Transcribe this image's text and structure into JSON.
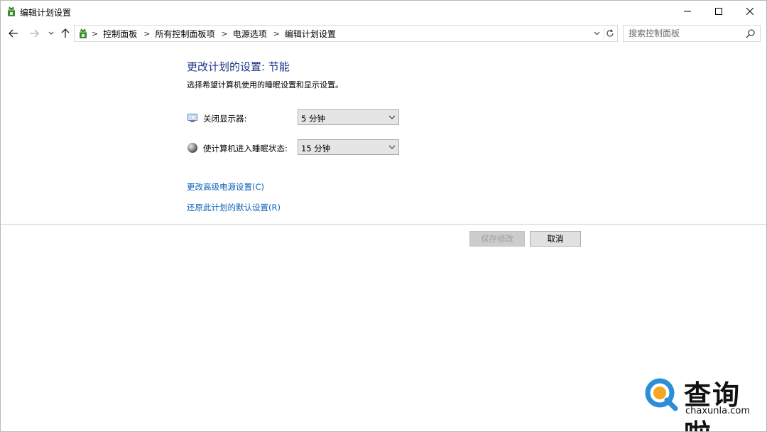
{
  "window": {
    "title": "编辑计划设置",
    "controls": {
      "minimize": "minimize-icon",
      "maximize": "maximize-icon",
      "close": "close-icon"
    }
  },
  "nav": {
    "back_icon": "arrow-left-icon",
    "forward_icon": "arrow-right-icon",
    "recent_icon": "chevron-down-icon",
    "up_icon": "arrow-up-icon",
    "breadcrumbs": [
      "控制面板",
      "所有控制面板项",
      "电源选项",
      "编辑计划设置"
    ],
    "refresh_icon": "refresh-icon",
    "search": {
      "placeholder": "搜索控制面板",
      "value": ""
    }
  },
  "content": {
    "heading": "更改计划的设置: 节能",
    "subtitle": "选择希望计算机使用的睡眠设置和显示设置。",
    "settings": [
      {
        "label": "关闭显示器:",
        "value": "5 分钟",
        "icon": "display-icon"
      },
      {
        "label": "使计算机进入睡眠状态:",
        "value": "15 分钟",
        "icon": "sleep-moon-icon"
      }
    ],
    "links": [
      "更改高级电源设置(C)",
      "还原此计划的默认设置(R)"
    ],
    "buttons": {
      "save": "保存修改",
      "cancel": "取消"
    }
  },
  "watermark": {
    "text": "查询啦",
    "domain": "chaxunla.com"
  },
  "colors": {
    "heading": "#1e3287",
    "link": "#0a63b8",
    "watermark_blue": "#2a8fd8",
    "watermark_orange": "#f5a623"
  }
}
